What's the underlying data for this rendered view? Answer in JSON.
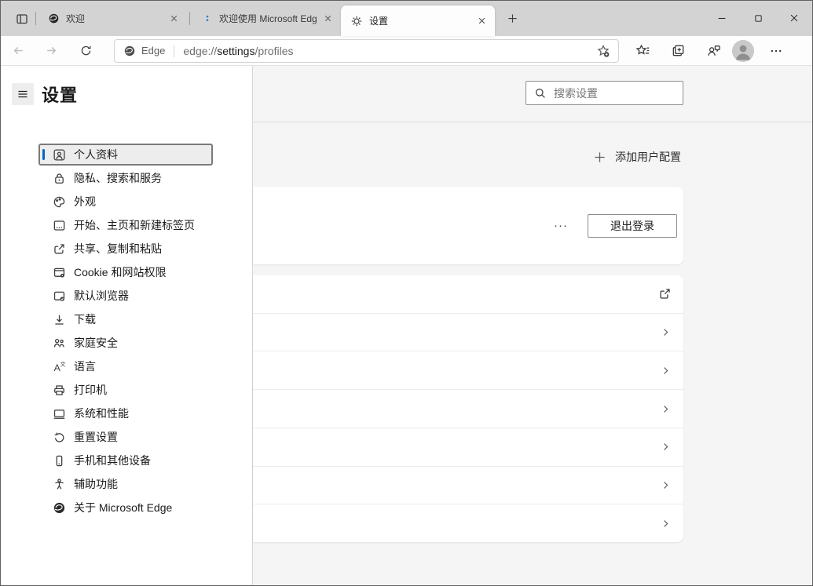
{
  "tab_bar": {
    "tabs": [
      {
        "title": "欢迎",
        "icon": "edge-logo-icon",
        "active": false
      },
      {
        "title": "欢迎使用 Microsoft Edg",
        "icon": "tab-loading-icon",
        "active": false
      },
      {
        "title": "设置",
        "icon": "gear-icon",
        "active": true
      }
    ],
    "icons": {
      "tab_actions": "tab-actions-icon",
      "new_tab": "plus-icon",
      "window_controls": [
        "minimize-icon",
        "maximize-icon",
        "close-icon"
      ]
    }
  },
  "toolbar": {
    "address": {
      "site_label": "Edge",
      "scheme": "edge://",
      "highlight": "settings",
      "path": "/profiles"
    },
    "icons": [
      "back-icon",
      "forward-icon",
      "refresh-icon",
      "add-favorite-icon",
      "favorites-icon",
      "collections-icon",
      "feedback-icon",
      "profile-avatar",
      "more-icon"
    ]
  },
  "settings_page": {
    "title": "设置",
    "search": {
      "placeholder": "搜索设置"
    },
    "nav_items": [
      {
        "label": "个人资料",
        "icon": "profile-card-icon",
        "selected": true
      },
      {
        "label": "隐私、搜索和服务",
        "icon": "lock-icon",
        "selected": false
      },
      {
        "label": "外观",
        "icon": "palette-icon",
        "selected": false
      },
      {
        "label": "开始、主页和新建标签页",
        "icon": "home-tabs-icon",
        "selected": false
      },
      {
        "label": "共享、复制和粘贴",
        "icon": "share-icon",
        "selected": false
      },
      {
        "label": "Cookie 和网站权限",
        "icon": "cookie-icon",
        "selected": false
      },
      {
        "label": "默认浏览器",
        "icon": "default-browser-icon",
        "selected": false
      },
      {
        "label": "下载",
        "icon": "download-icon",
        "selected": false
      },
      {
        "label": "家庭安全",
        "icon": "family-icon",
        "selected": false
      },
      {
        "label": "语言",
        "icon": "language-icon",
        "selected": false
      },
      {
        "label": "打印机",
        "icon": "printer-icon",
        "selected": false
      },
      {
        "label": "系统和性能",
        "icon": "system-icon",
        "selected": false
      },
      {
        "label": "重置设置",
        "icon": "reset-icon",
        "selected": false
      },
      {
        "label": "手机和其他设备",
        "icon": "phone-icon",
        "selected": false
      },
      {
        "label": "辅助功能",
        "icon": "accessibility-icon",
        "selected": false
      },
      {
        "label": "关于 Microsoft Edge",
        "icon": "edge-logo-icon",
        "selected": false
      }
    ],
    "content": {
      "add_profile_label": "添加用户配置",
      "profile_card": {
        "more_label": "···",
        "sign_out_label": "退出登录"
      },
      "list_rows": [
        {
          "icon": "external-link-icon"
        },
        {
          "icon": "chevron-right-icon"
        },
        {
          "icon": "chevron-right-icon"
        },
        {
          "icon": "chevron-right-icon"
        },
        {
          "icon": "chevron-right-icon"
        },
        {
          "icon": "chevron-right-icon"
        },
        {
          "icon": "chevron-right-icon"
        }
      ]
    }
  },
  "colors": {
    "accent_blue": "#0067c0",
    "tab_bar_bg": "#d3d3d3",
    "page_bg": "#f5f5f5",
    "loading_dot_blue": "#2b7cd3"
  }
}
